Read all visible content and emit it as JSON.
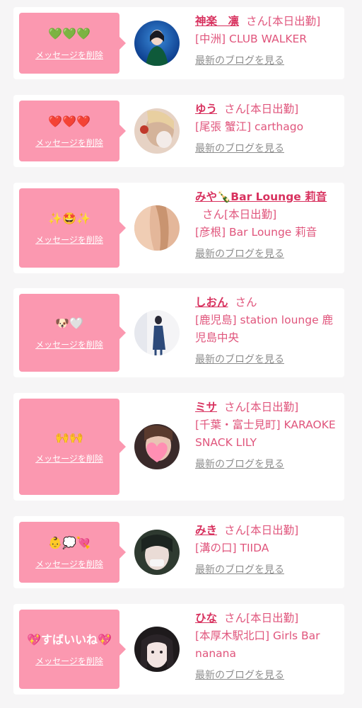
{
  "colors": {
    "bubble": "#fb98b0",
    "name": "#d8325f",
    "text": "#e0557c",
    "blog": "#8e8e8e",
    "background": "#f6f5f6"
  },
  "delete_label": "メッセージを削除",
  "blog_label": "最新のブログを見る",
  "entries": [
    {
      "message": "💚💚💚",
      "name": "神楽　凛",
      "honorific": "さん",
      "status": "[本日出勤]",
      "shop": "[中洲] CLUB WALKER"
    },
    {
      "message": "❤️❤️❤️",
      "name": "ゆう",
      "honorific": "さん",
      "status": "[本日出勤]",
      "shop": "[尾張 蟹江] carthago"
    },
    {
      "message": "✨🤩✨",
      "name": "みや🍾Bar Lounge 莉音",
      "honorific": "さん",
      "status": "[本日出勤]",
      "shop": "[彦根] Bar Lounge 莉音"
    },
    {
      "message": "🐶🤍",
      "name": "しおん",
      "honorific": "さん",
      "status": "",
      "shop": "[鹿児島] station lounge 鹿児島中央"
    },
    {
      "message": "🙌🙌",
      "name": "ミサ",
      "honorific": "さん",
      "status": "[本日出勤]",
      "shop": "[千葉・富士見町] KARAOKE SNACK LILY"
    },
    {
      "message": "👶💭💘",
      "name": "みき",
      "honorific": "さん",
      "status": "[本日出勤]",
      "shop": "[溝の口] TIIDA"
    },
    {
      "message": "💖すばいいね💖",
      "name": "ひな",
      "honorific": "さん",
      "status": "[本日出勤]",
      "shop": "[本厚木駅北口] Girls Bar nanana"
    }
  ]
}
